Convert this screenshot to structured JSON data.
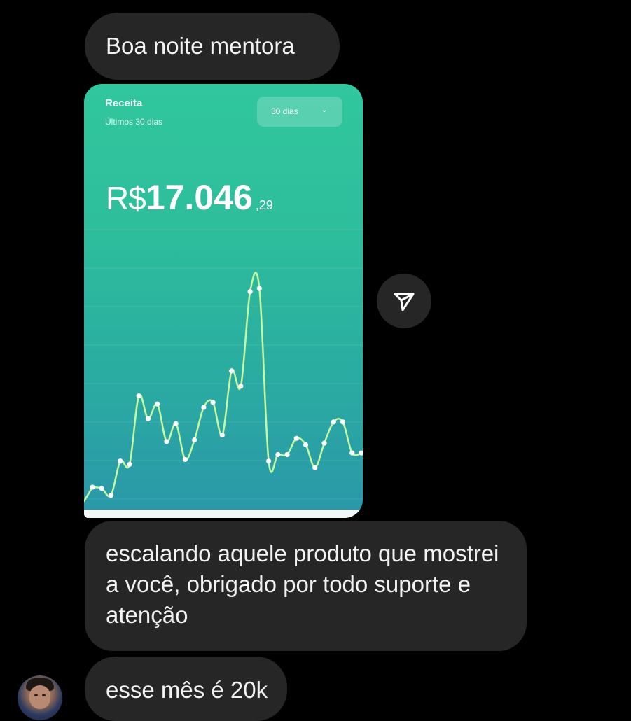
{
  "messages": [
    {
      "text": "Boa noite mentora"
    },
    {
      "text": "escalando aquele produto que mostrei a você, obrigado por todo suporte e atenção"
    },
    {
      "text": "esse mês é 20k"
    }
  ],
  "shared_card": {
    "title": "Receita",
    "subtitle": "Últimos 30 dias",
    "period_dropdown": "30 dias",
    "amount": {
      "currency": "R$",
      "integer": "17.046",
      "cents": ",29"
    }
  },
  "chart_data": {
    "type": "line",
    "x": [
      1,
      2,
      3,
      4,
      5,
      6,
      7,
      8,
      9,
      10,
      11,
      12,
      13,
      14,
      15,
      16,
      17,
      18,
      19,
      20,
      21,
      22,
      23,
      24,
      25,
      26,
      27,
      28,
      29,
      30
    ],
    "values": [
      3,
      2.6,
      0.5,
      11,
      10,
      31,
      24,
      28.5,
      17,
      22.5,
      11.5,
      17.5,
      27.5,
      29,
      19,
      38.7,
      34,
      63,
      64,
      11,
      13,
      13,
      18,
      16,
      9,
      16.5,
      23,
      23,
      13.5,
      13.5
    ],
    "title": "",
    "xlabel": "",
    "ylabel": "",
    "ylim": [
      0,
      70
    ],
    "grid": true,
    "line_color": "#c6f7a2",
    "point_color": "#ffffff"
  },
  "icons": {
    "share": "paper-plane-icon",
    "dropdown": "chevron-down-icon",
    "avatar": "user-avatar"
  }
}
